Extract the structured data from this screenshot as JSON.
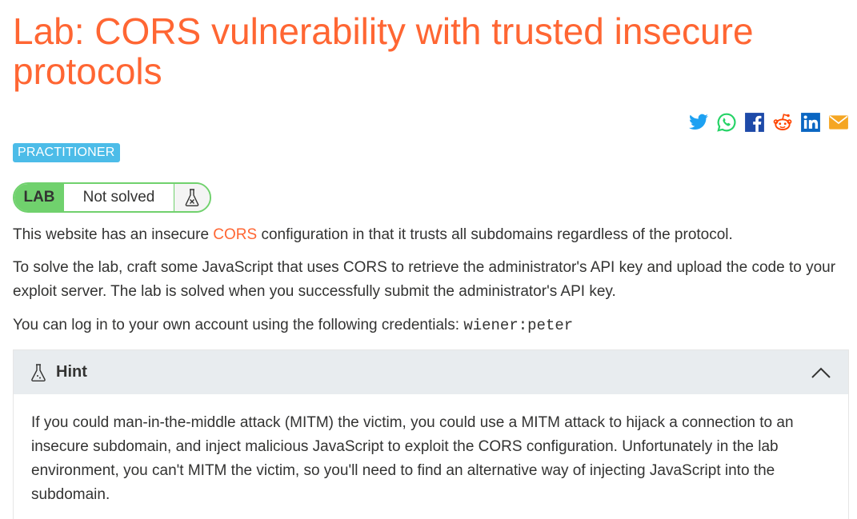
{
  "title": "Lab: CORS vulnerability with trusted insecure protocols",
  "share": {
    "icons": [
      "twitter-icon",
      "whatsapp-icon",
      "facebook-icon",
      "reddit-icon",
      "linkedin-icon",
      "email-icon"
    ]
  },
  "level_badge": "PRACTITIONER",
  "lab_widget": {
    "tag": "LAB",
    "status": "Not solved"
  },
  "description": {
    "p1_before": "This website has an insecure ",
    "p1_link": "CORS",
    "p1_after": " configuration in that it trusts all subdomains regardless of the protocol.",
    "p2": "To solve the lab, craft some JavaScript that uses CORS to retrieve the administrator's API key and upload the code to your exploit server. The lab is solved when you successfully submit the administrator's API key.",
    "p3_text": "You can log in to your own account using the following credentials: ",
    "p3_credentials": "wiener:peter"
  },
  "hint": {
    "title": "Hint",
    "body": "If you could man-in-the-middle attack (MITM) the victim, you could use a MITM attack to hijack a connection to an insecure subdomain, and inject malicious JavaScript to exploit the CORS configuration. Unfortunately in the lab environment, you can't MITM the victim, so you'll need to find an alternative way of injecting JavaScript into the subdomain."
  },
  "colors": {
    "accent": "#ff6633",
    "badge": "#4cbce8",
    "lab_green": "#70d16d",
    "hint_header_bg": "#e8ecef"
  }
}
